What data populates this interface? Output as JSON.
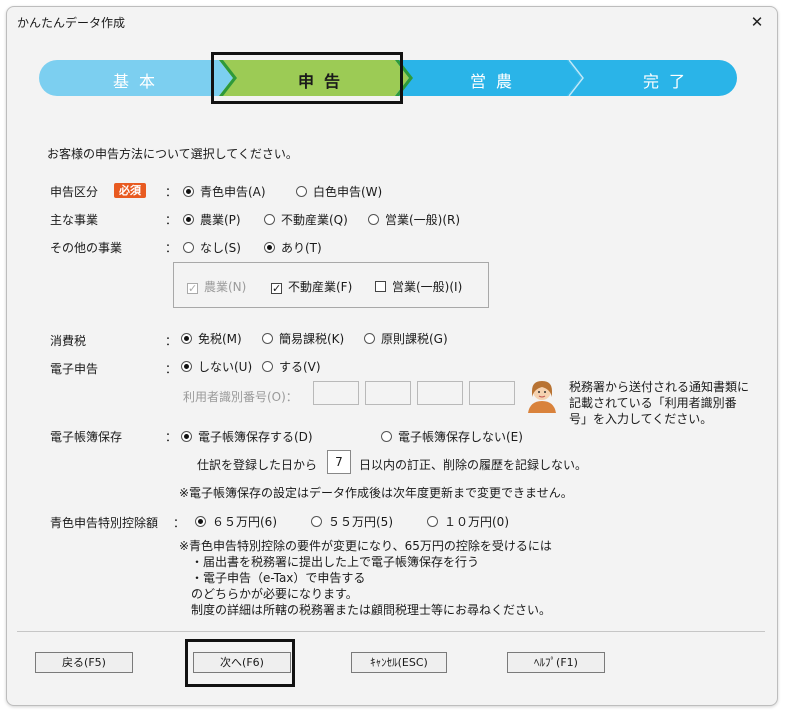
{
  "window": {
    "title": "かんたんデータ作成",
    "close_glyph": "✕"
  },
  "steps": {
    "items": [
      "基本",
      "申告",
      "営農",
      "完了"
    ],
    "active_index": 1,
    "colors": {
      "inactive": "#2ab4e8",
      "active": "#9ccb55"
    }
  },
  "intro": "お客様の申告方法について選択してください。",
  "form": {
    "colon": "：",
    "filing": {
      "label": "申告区分",
      "badge": "必須",
      "opt_blue": "青色申告(A)",
      "opt_white": "白色申告(W)",
      "selected": "blue"
    },
    "main_business": {
      "label": "主な事業",
      "opt_agri": "農業(P)",
      "opt_realestate": "不動産業(Q)",
      "opt_business": "営業(一般)(R)",
      "selected": "agri"
    },
    "other_business": {
      "label": "その他の事業",
      "opt_none": "なし(S)",
      "opt_yes": "あり(T)",
      "selected": "yes",
      "checks": {
        "agri": "農業(N)",
        "realestate": "不動産業(F)",
        "business": "営業(一般)(I)"
      }
    },
    "consumption_tax": {
      "label": "消費税",
      "opt_exempt": "免税(M)",
      "opt_simple": "簡易課税(K)",
      "opt_standard": "原則課税(G)",
      "selected": "exempt"
    },
    "e_filing": {
      "label": "電子申告",
      "opt_no": "しない(U)",
      "opt_yes": "する(V)",
      "selected": "no",
      "user_id_label": "利用者識別番号(O)：",
      "help_text": "税務署から送付される通知書類に記載されている「利用者識別番号」を入力してください。"
    },
    "e_books": {
      "label": "電子帳簿保存",
      "opt_yes": "電子帳簿保存する(D)",
      "opt_no": "電子帳簿保存しない(E)",
      "selected": "yes",
      "days_prefix": "仕訳を登録した日から",
      "days_value": "7",
      "days_suffix": "日以内の訂正、削除の履歴を記録しない。",
      "note": "※電子帳簿保存の設定はデータ作成後は次年度更新まで変更できません。"
    },
    "blue_deduction": {
      "label": "青色申告特別控除額",
      "opt_65": "６５万円(6)",
      "opt_55": "５５万円(5)",
      "opt_10": "１０万円(0)",
      "selected": "65",
      "notes": [
        "※青色申告特別控除の要件が変更になり、65万円の控除を受けるには",
        "・届出書を税務署に提出した上で電子帳簿保存を行う",
        "・電子申告（e-Tax）で申告する",
        "のどちらかが必要になります。",
        "制度の詳細は所轄の税務署または顧問税理士等にお尋ねください。"
      ]
    }
  },
  "buttons": {
    "back": "戻る(F5)",
    "next": "次へ(F6)",
    "cancel": "ｷｬﾝｾﾙ(ESC)",
    "help": "ﾍﾙﾌﾟ(F1)"
  }
}
